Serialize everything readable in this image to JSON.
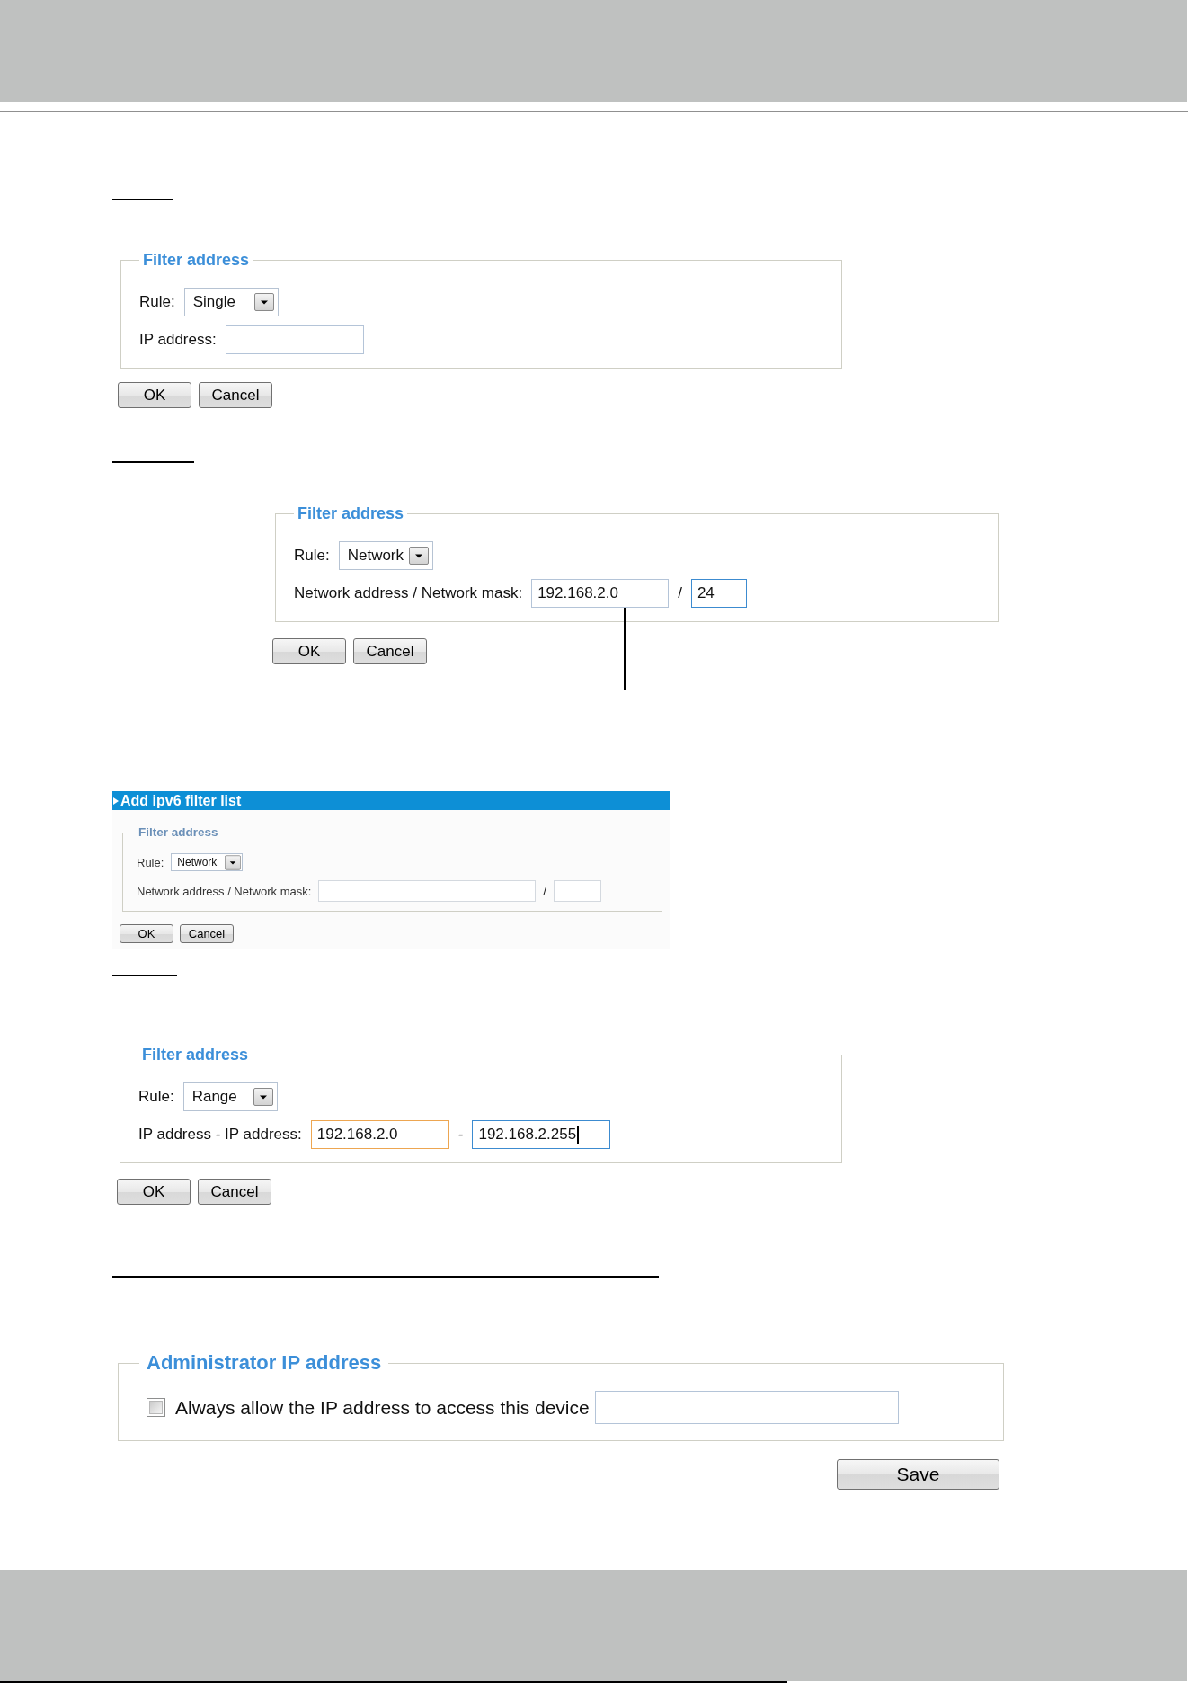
{
  "sections": [
    {
      "kind": "single",
      "form": {
        "legend": "Filter address",
        "rule_label": "Rule:",
        "rule_value": "Single",
        "address_label": "IP address:",
        "inputs": [
          {
            "hovered": false,
            "focused": false,
            "caret": false
          }
        ]
      },
      "buttons": [
        "OK",
        "Cancel"
      ]
    },
    {
      "kind": "network",
      "form": {
        "legend": "Filter address",
        "rule_label": "Rule:",
        "rule_value": "Network",
        "address_label": "Network address / Network mask:",
        "separator": "/",
        "inputs": [
          {
            "value": "192.168.2.0",
            "hovered": false,
            "focused": false,
            "caret": false
          },
          {
            "value": "24",
            "hovered": false,
            "focused": true,
            "caret": false
          }
        ]
      },
      "buttons": [
        "OK",
        "Cancel"
      ]
    },
    {
      "kind": "inset",
      "title": "Add ipv6 filter list",
      "form": {
        "legend": "Filter address",
        "rule_label": "Rule:",
        "rule_value": "Network",
        "address_label": "Network address / Network mask:",
        "separator": "/",
        "inputs": [
          {
            "hovered": false,
            "focused": false,
            "caret": false
          },
          {
            "hovered": false,
            "focused": false,
            "caret": false
          }
        ]
      },
      "buttons": [
        "OK",
        "Cancel"
      ]
    },
    {
      "kind": "range",
      "form": {
        "legend": "Filter address",
        "rule_label": "Rule:",
        "rule_value": "Range",
        "address_label": "IP address - IP address:",
        "separator": "-",
        "inputs": [
          {
            "value": "192.168.2.0",
            "hovered": true,
            "focused": false,
            "caret": false
          },
          {
            "value": "192.168.2.255",
            "hovered": false,
            "focused": true,
            "caret": true
          }
        ]
      },
      "buttons": [
        "OK",
        "Cancel"
      ]
    },
    {
      "kind": "admin",
      "legend": "Administrator IP address",
      "checkbox_label": "Always allow the IP address to access this device",
      "checked": false,
      "input": {
        "hovered": false,
        "focused": false,
        "caret": false
      },
      "button": "Save"
    }
  ]
}
